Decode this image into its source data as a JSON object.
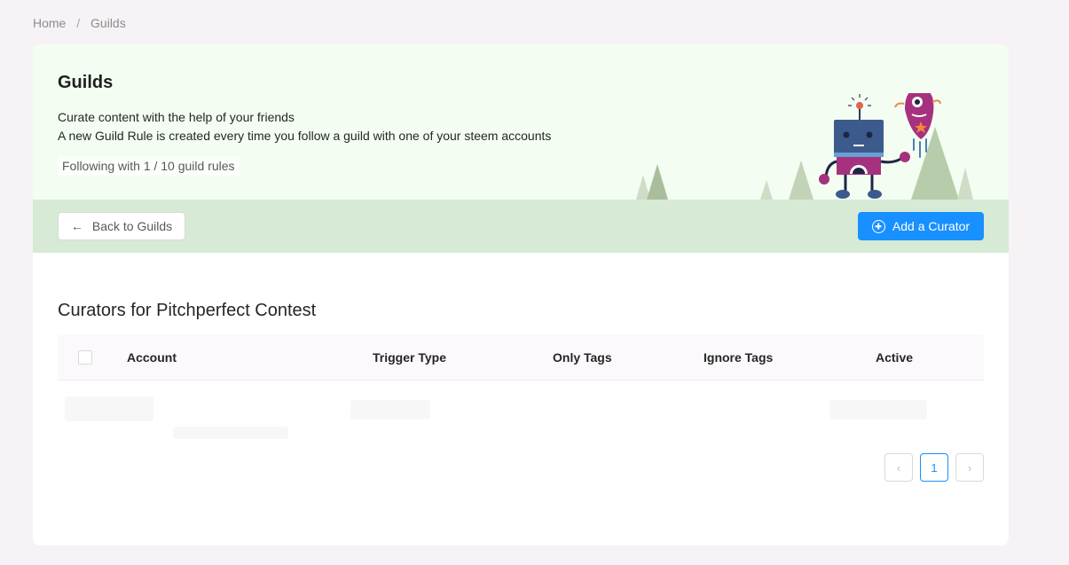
{
  "breadcrumb": {
    "home": "Home",
    "separator": "/",
    "current": "Guilds"
  },
  "hero": {
    "title": "Guilds",
    "line1": "Curate content with the help of your friends",
    "line2": "A new Guild Rule is created every time you follow a guild with one of your steem accounts",
    "following": "Following with 1 / 10 guild rules"
  },
  "actions": {
    "back_label": "Back to Guilds",
    "add_label": "Add a Curator"
  },
  "section": {
    "title": "Curators for Pitchperfect Contest"
  },
  "table": {
    "columns": [
      "Account",
      "Trigger Type",
      "Only Tags",
      "Ignore Tags",
      "Active"
    ]
  },
  "pagination": {
    "current_page": "1",
    "prev_icon": "chevron-left-icon",
    "next_icon": "chevron-right-icon"
  },
  "colors": {
    "accent": "#1890ff",
    "hero_bg": "#f3fdf2",
    "action_bar_bg": "#d6ead6"
  }
}
